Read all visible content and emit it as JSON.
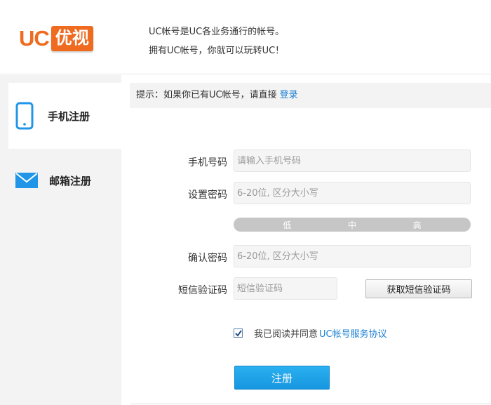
{
  "header": {
    "logo_uc": "UC",
    "logo_cn": "优视",
    "intro_line1": "UC帐号是UC各业务通行的帐号。",
    "intro_line2": "拥有UC帐号，你就可以玩转UC！"
  },
  "sidebar": {
    "items": [
      {
        "label": "手机注册",
        "icon": "phone-icon",
        "active": true
      },
      {
        "label": "邮箱注册",
        "icon": "mail-icon",
        "active": false
      }
    ]
  },
  "tip": {
    "text": "提示：如果你已有UC帐号，请直接",
    "login_link": "登录"
  },
  "form": {
    "phone_label": "手机号码",
    "phone_placeholder": "请输入手机号码",
    "password_label": "设置密码",
    "password_placeholder": "6-20位, 区分大小写",
    "strength": {
      "low": "低",
      "mid": "中",
      "high": "高"
    },
    "confirm_label": "确认密码",
    "confirm_placeholder": "6-20位, 区分大小写",
    "sms_label": "短信验证码",
    "sms_placeholder": "短信验证码",
    "sms_button": "获取短信验证码",
    "agree_text": "我已阅读并同意",
    "agree_link": "UC帐号服务协议",
    "agree_checked": true,
    "submit": "注册"
  },
  "colors": {
    "brand_orange": "#ee6b1f",
    "link_blue": "#1a7fd4",
    "submit_blue": "#1796e0",
    "icon_blue": "#2196e8"
  }
}
